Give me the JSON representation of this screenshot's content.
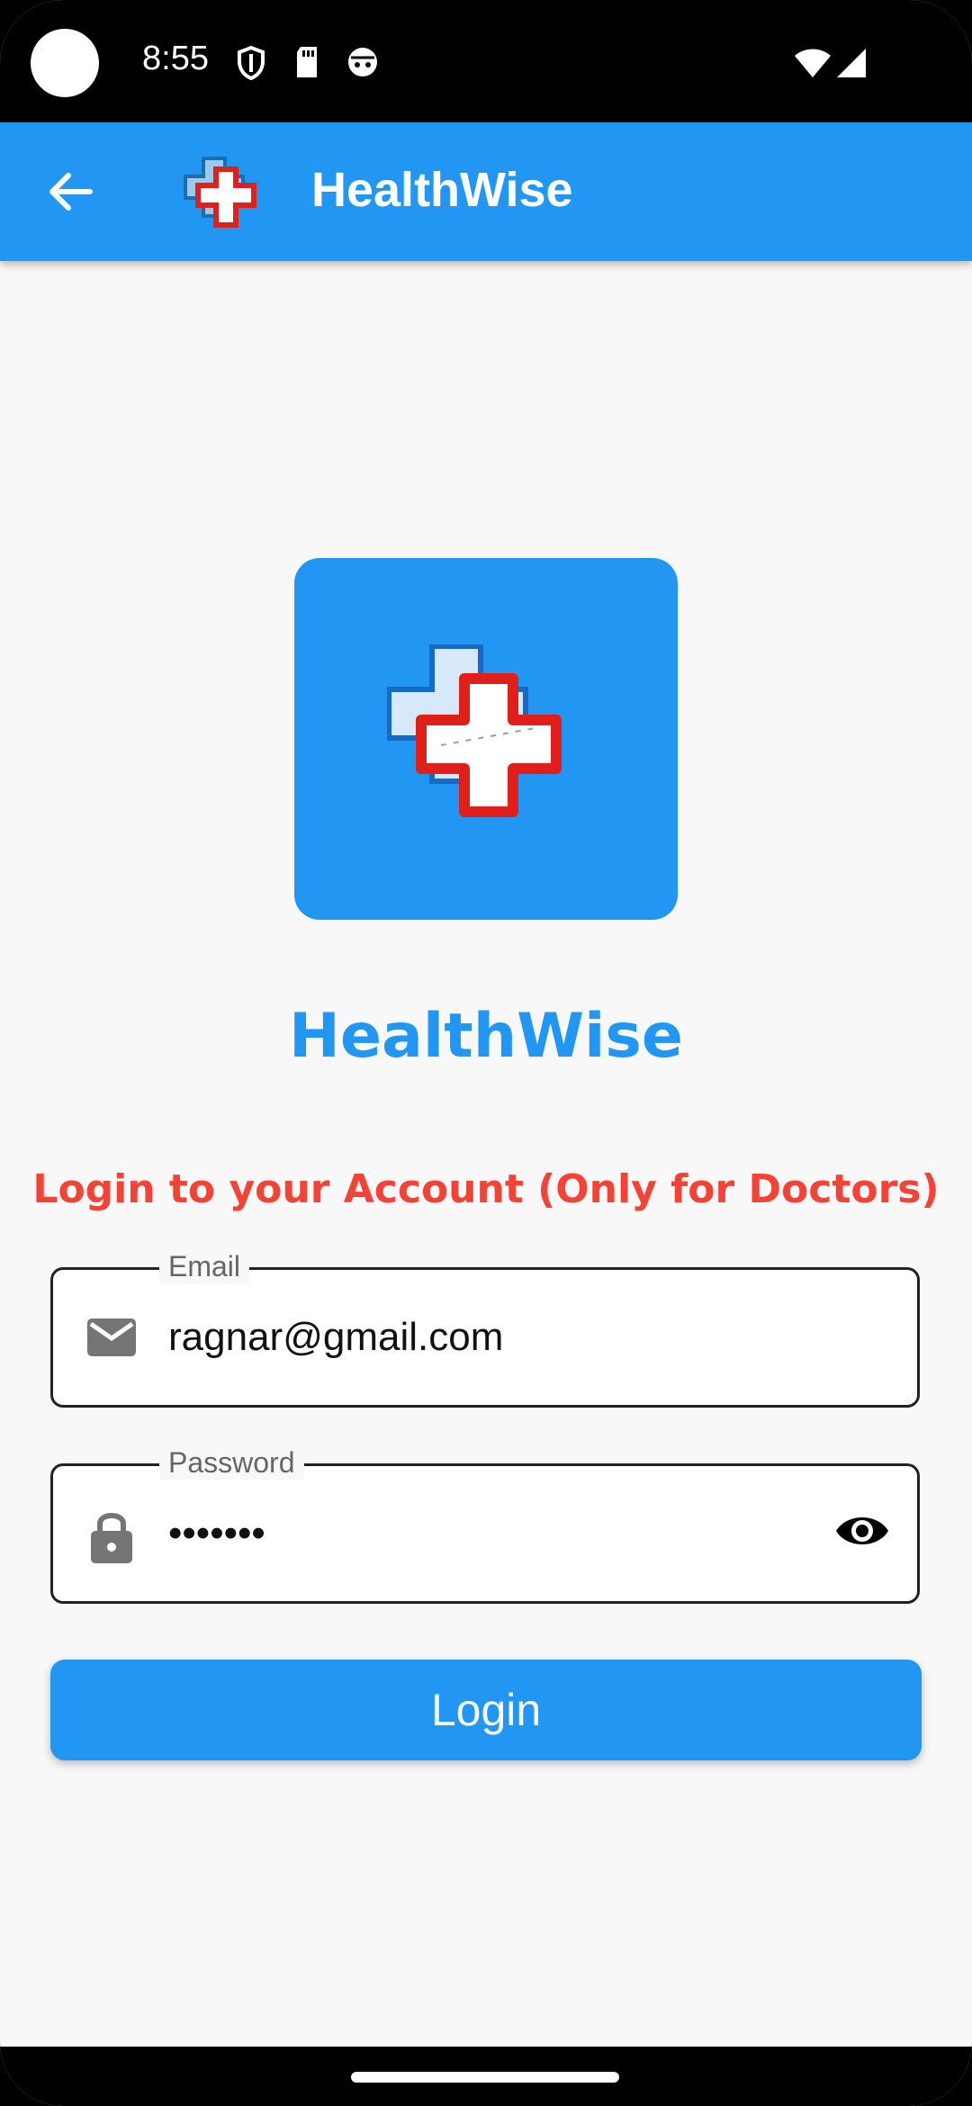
{
  "status_bar": {
    "time": "8:55"
  },
  "app_bar": {
    "title": "HealthWise"
  },
  "brand": {
    "name": "HealthWise"
  },
  "login": {
    "heading": "Login to your Account (Only for Doctors)",
    "email": {
      "label": "Email",
      "value": "ragnar@gmail.com"
    },
    "password": {
      "label": "Password",
      "value": "•••••••"
    },
    "button_label": "Login"
  },
  "icons": {
    "back": "arrow-back-icon",
    "email": "mail-icon",
    "password": "lock-icon",
    "visibility": "eye-icon"
  },
  "colors": {
    "primary": "#2196f3",
    "accent": "#f44336"
  }
}
